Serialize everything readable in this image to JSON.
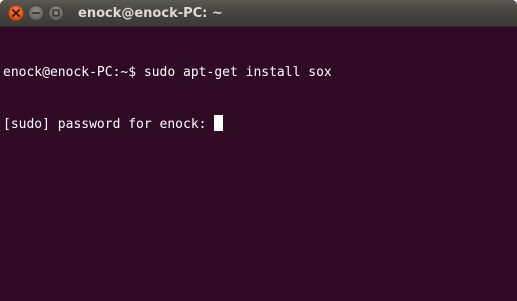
{
  "window": {
    "title": "enock@enock-PC: ~"
  },
  "controls": {
    "close": "close-icon",
    "minimize": "minimize-icon",
    "maximize": "maximize-icon"
  },
  "terminal": {
    "lines": [
      "enock@enock-PC:~$ sudo apt-get install sox",
      "[sudo] password for enock: "
    ],
    "background": "#300a24",
    "foreground": "#ffffff"
  }
}
